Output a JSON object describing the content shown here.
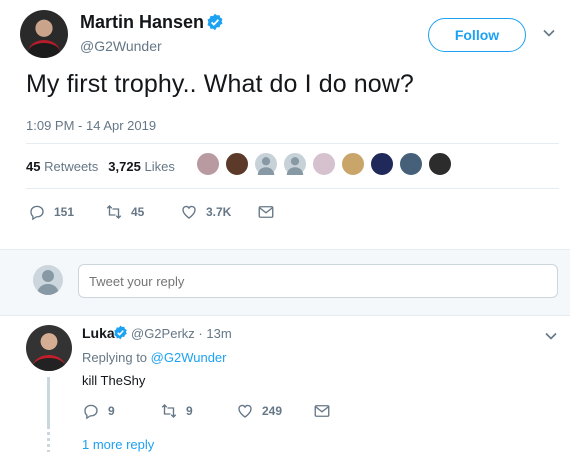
{
  "tweet": {
    "author_name": "Martin Hansen",
    "author_handle": "@G2Wunder",
    "follow_label": "Follow",
    "text": "My first trophy.. What do I do now?",
    "timestamp": "1:09 PM - 14 Apr 2019",
    "retweets_count": "45",
    "retweets_label": "Retweets",
    "likes_count": "3,725",
    "likes_label": "Likes",
    "actions": {
      "reply_count": "151",
      "retweet_count": "45",
      "like_count": "3.7K"
    }
  },
  "reply_box": {
    "placeholder": "Tweet your reply"
  },
  "reply": {
    "author_name": "Luka",
    "author_handle": "@G2Perkz",
    "separator": "·",
    "time": "13m",
    "replying_prefix": "Replying to",
    "replying_to": "@G2Wunder",
    "text": "kill TheShy",
    "actions": {
      "reply_count": "9",
      "retweet_count": "9",
      "like_count": "249"
    },
    "more_replies": "1 more reply"
  },
  "colors": {
    "accent": "#1da1f2",
    "muted": "#657786",
    "text": "#14171a",
    "divider": "#e6ecf0",
    "band": "#f5f8fa"
  },
  "likers": [
    {
      "color": "#b89aa0",
      "icon": "avatar"
    },
    {
      "color": "#5b3a29",
      "icon": "avatar"
    },
    {
      "color": "#c7d1d8",
      "icon": "default-avatar"
    },
    {
      "color": "#c7d1d8",
      "icon": "default-avatar"
    },
    {
      "color": "#d6c2cf",
      "icon": "avatar"
    },
    {
      "color": "#c9a56a",
      "icon": "avatar"
    },
    {
      "color": "#1f2a5a",
      "icon": "avatar"
    },
    {
      "color": "#46607a",
      "icon": "avatar"
    },
    {
      "color": "#2c2c2c",
      "icon": "avatar"
    }
  ]
}
